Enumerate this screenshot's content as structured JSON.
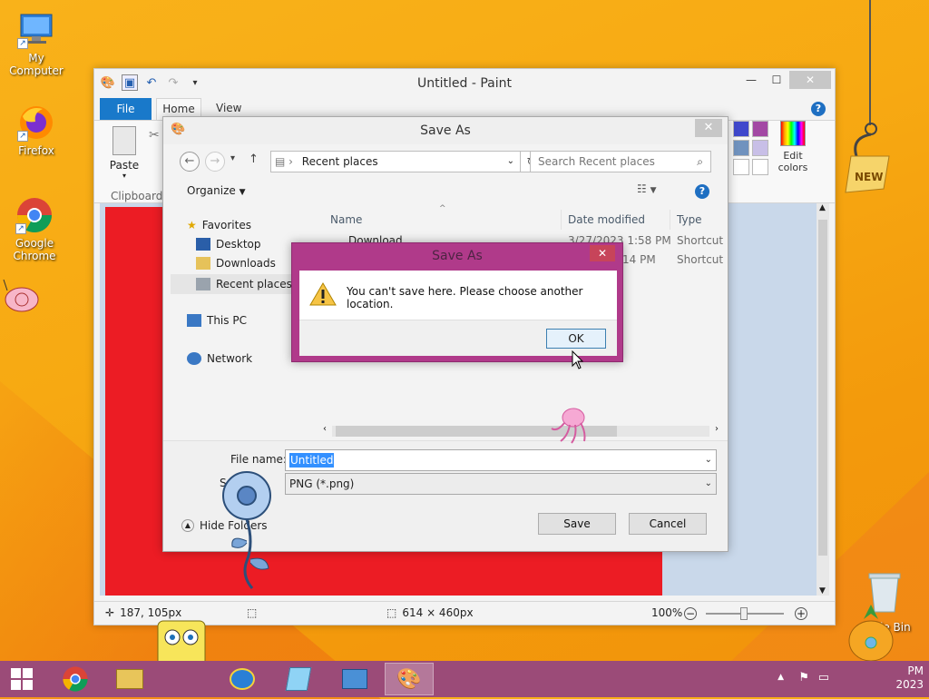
{
  "desktop": {
    "icons": [
      {
        "label": "My Computer"
      },
      {
        "label": "Firefox"
      },
      {
        "label": "Google Chrome"
      },
      {
        "label": "Recycle Bin"
      }
    ],
    "recycle_visible_text": "le Bin",
    "badge_new": "NEW"
  },
  "paint": {
    "title": "Untitled - Paint",
    "tabs": {
      "file": "File",
      "home": "Home",
      "view": "View"
    },
    "clipboard": {
      "paste_label": "Paste",
      "group_label": "Clipboard"
    },
    "edit_colors_label": "Edit colors",
    "palette_colors": [
      "#3f48cc",
      "#a349a4",
      "#7092be",
      "#c8bfe7",
      "#ffffff",
      "#ffffff"
    ],
    "canvas_color": "#ec1c24",
    "status": {
      "cursor_pos": "187, 105px",
      "image_size": "614 × 460px",
      "zoom": "100%"
    }
  },
  "save_as": {
    "title": "Save As",
    "address": "Recent places",
    "search_placeholder": "Search Recent places",
    "organize_label": "Organize",
    "nav": {
      "favorites": "Favorites",
      "desktop": "Desktop",
      "downloads": "Downloads",
      "recent_places": "Recent places",
      "this_pc": "This PC",
      "network": "Network"
    },
    "columns": {
      "name": "Name",
      "date": "Date modified",
      "type": "Type"
    },
    "rows": [
      {
        "name": "Download",
        "date": "3/27/2023 1:58 PM",
        "type": "Shortcut"
      },
      {
        "name": "",
        "date": "14 PM",
        "type": "Shortcut"
      }
    ],
    "file_name_label": "File name:",
    "file_name_value": "Untitled",
    "save_type_label": "S",
    "save_type_value": "PNG (*.png)",
    "hide_folders_label": "Hide Folders",
    "save_button": "Save",
    "cancel_button": "Cancel"
  },
  "alert": {
    "title": "Save As",
    "message": "You can't save here. Please choose another location.",
    "ok_label": "OK"
  },
  "taskbar": {
    "clock_time": "PM",
    "clock_date": "2023"
  },
  "colors": {
    "accent_blue": "#1979ca",
    "taskbar": "#9b4b78",
    "alert_border": "#b03a8a"
  }
}
